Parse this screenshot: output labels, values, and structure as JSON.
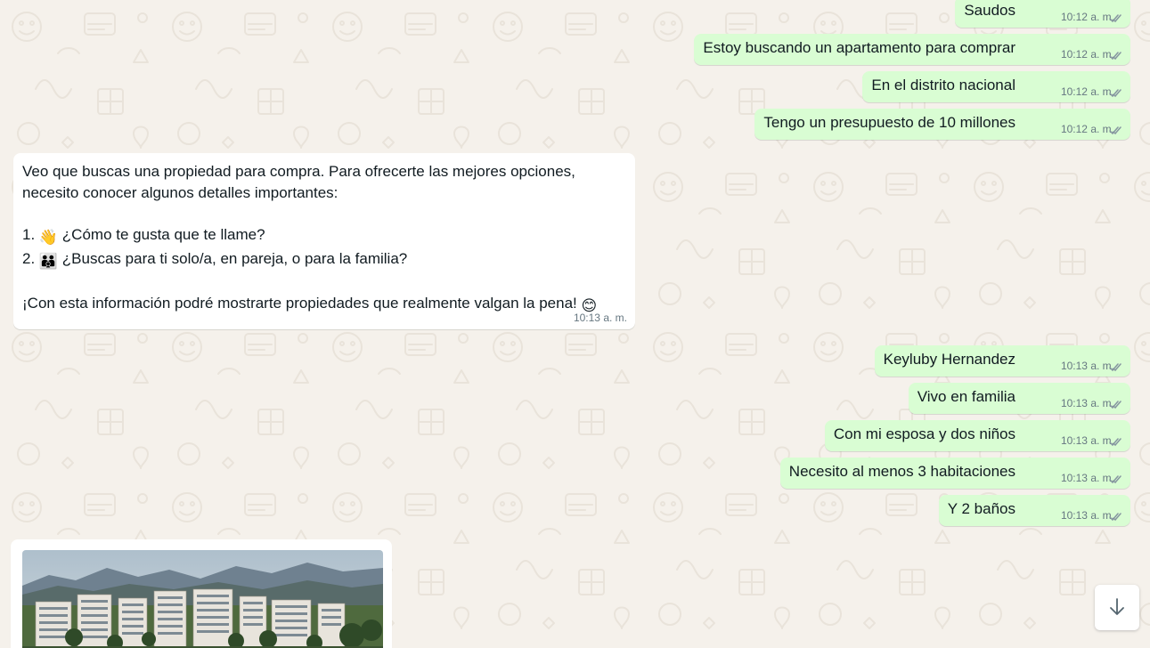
{
  "outgoing_messages": [
    {
      "text": "Saudos",
      "time": "10:12 a. m."
    },
    {
      "text": "Estoy buscando un apartamento para comprar",
      "time": "10:12 a. m."
    },
    {
      "text": "En el distrito nacional",
      "time": "10:12 a. m."
    },
    {
      "text": "Tengo un presupuesto de 10 millones",
      "time": "10:12 a. m."
    },
    {
      "text": "Keyluby Hernandez",
      "time": "10:13 a. m."
    },
    {
      "text": "Vivo en familia",
      "time": "10:13 a. m."
    },
    {
      "text": "Con mi esposa y dos niños",
      "time": "10:13 a. m."
    },
    {
      "text": "Necesito al menos 3 habitaciones",
      "time": "10:13 a. m."
    },
    {
      "text": "Y 2 baños",
      "time": "10:13 a. m."
    }
  ],
  "incoming_message": {
    "line1": "Veo que buscas una propiedad para compra. Para ofrecerte las mejores opciones,",
    "line2": "necesito conocer algunos detalles importantes:",
    "q1_prefix": "1. ",
    "q1_emoji": "👋",
    "q1_text": " ¿Cómo te gusta que te llame?",
    "q2_prefix": "2. ",
    "q2_emoji": "👪",
    "q2_text": " ¿Buscas para ti solo/a, en pareja, o para la familia?",
    "closing": "¡Con esta información podré mostrarte propiedades que realmente valgan la pena! ",
    "closing_emoji": "😊",
    "time": "10:13 a. m."
  },
  "image_message": {
    "subject": "apartment-buildings-photo"
  },
  "scroll_button": {
    "icon": "arrow-down-icon"
  },
  "colors": {
    "chat_background": "#f5f1eb",
    "outgoing_bubble": "#d9fdd3",
    "incoming_bubble": "#ffffff",
    "timestamp": "#667781",
    "read_ticks": "#8696a0"
  }
}
